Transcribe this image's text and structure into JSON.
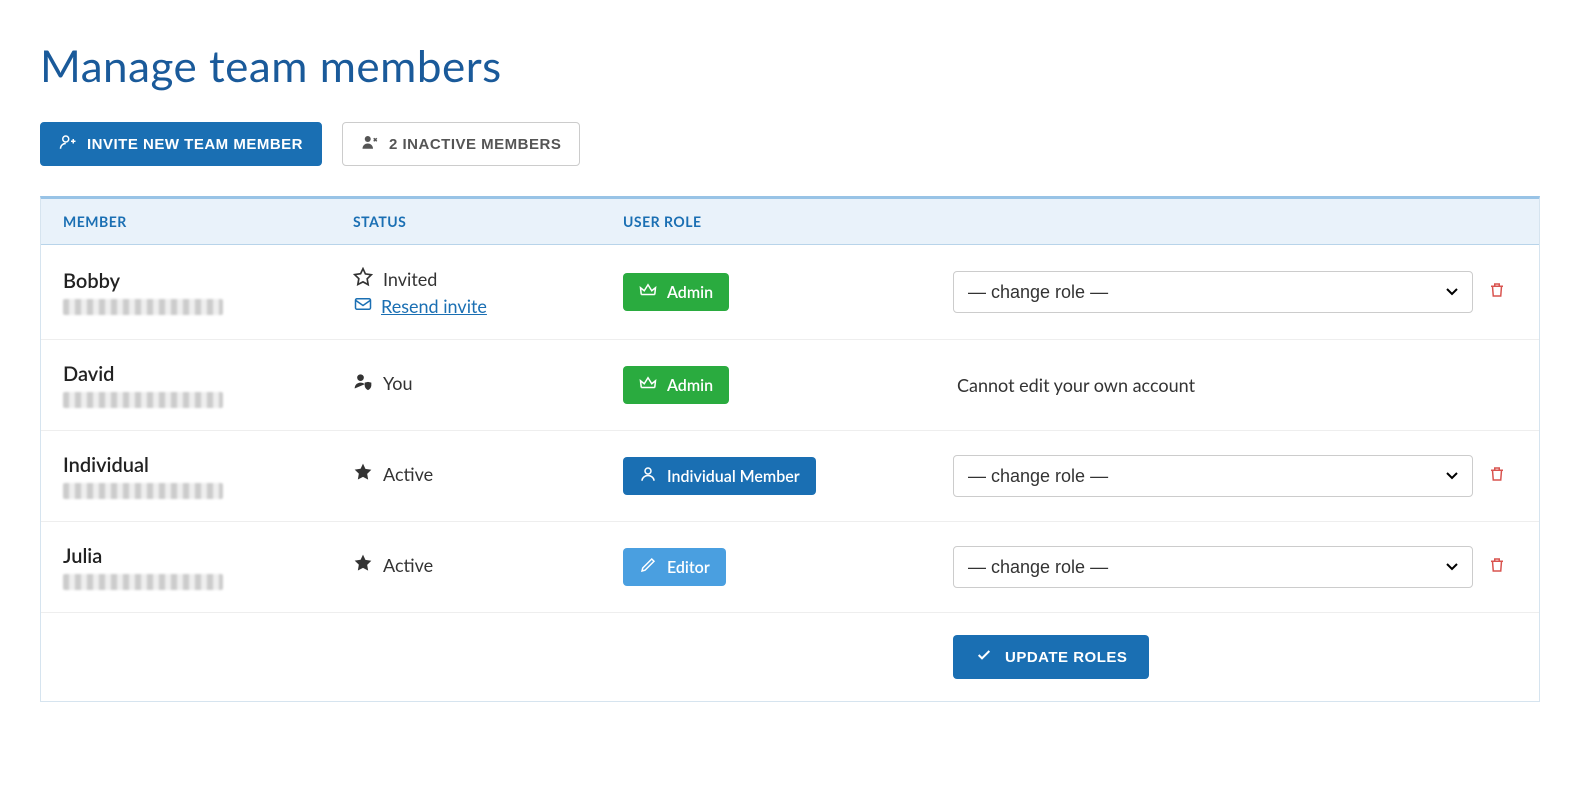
{
  "page_title": "Manage team members",
  "actions": {
    "invite_label": "INVITE NEW TEAM MEMBER",
    "inactive_label": "2 INACTIVE MEMBERS"
  },
  "columns": {
    "member": "MEMBER",
    "status": "STATUS",
    "role": "USER ROLE"
  },
  "change_role_placeholder": "— change role —",
  "locked_text": "Cannot edit your own account",
  "resend_label": "Resend invite",
  "update_label": "UPDATE ROLES",
  "roles": {
    "admin": "Admin",
    "individual_member": "Individual Member",
    "editor": "Editor"
  },
  "status_labels": {
    "invited": "Invited",
    "you": "You",
    "active": "Active"
  },
  "members": [
    {
      "name": "Bobby",
      "status_key": "invited",
      "show_resend": true,
      "role_key": "admin",
      "role_style": "green",
      "can_change": true,
      "can_delete": true
    },
    {
      "name": "David",
      "status_key": "you",
      "show_resend": false,
      "role_key": "admin",
      "role_style": "green",
      "can_change": false,
      "can_delete": false
    },
    {
      "name": "Individual",
      "status_key": "active",
      "show_resend": false,
      "role_key": "individual_member",
      "role_style": "blue",
      "can_change": true,
      "can_delete": true
    },
    {
      "name": "Julia",
      "status_key": "active",
      "show_resend": false,
      "role_key": "editor",
      "role_style": "light",
      "can_change": true,
      "can_delete": true
    }
  ]
}
